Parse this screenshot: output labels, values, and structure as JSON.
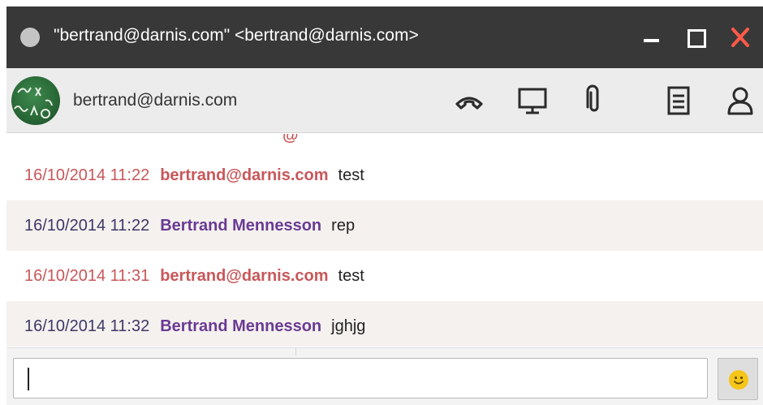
{
  "window": {
    "title": "\"bertrand@darnis.com\" <bertrand@darnis.com>",
    "status_color": "#c4c4c4",
    "close_color": "#ff5a49"
  },
  "toolbar": {
    "contact_name": "bertrand@darnis.com",
    "icons": [
      "phone-icon",
      "screen-share-icon",
      "attachment-icon",
      "notes-icon",
      "contact-icon"
    ]
  },
  "messages": {
    "partial_top": "@",
    "items": [
      {
        "time": "16/10/2014 11:22",
        "sender": "bertrand@darnis.com",
        "text": "test",
        "from": "me"
      },
      {
        "time": "16/10/2014 11:22",
        "sender": "Bertrand Mennesson",
        "text": "rep",
        "from": "them"
      },
      {
        "time": "16/10/2014 11:31",
        "sender": "bertrand@darnis.com",
        "text": "test",
        "from": "me"
      },
      {
        "time": "16/10/2014 11:32",
        "sender": "Bertrand Mennesson",
        "text": "jghjg",
        "from": "them"
      }
    ]
  },
  "composer": {
    "value": "",
    "placeholder": "",
    "emoji_icon": "smiley-icon"
  },
  "colors": {
    "self_sender": "#c8575a",
    "other_sender": "#6a3a94",
    "other_time": "#3e3868"
  }
}
